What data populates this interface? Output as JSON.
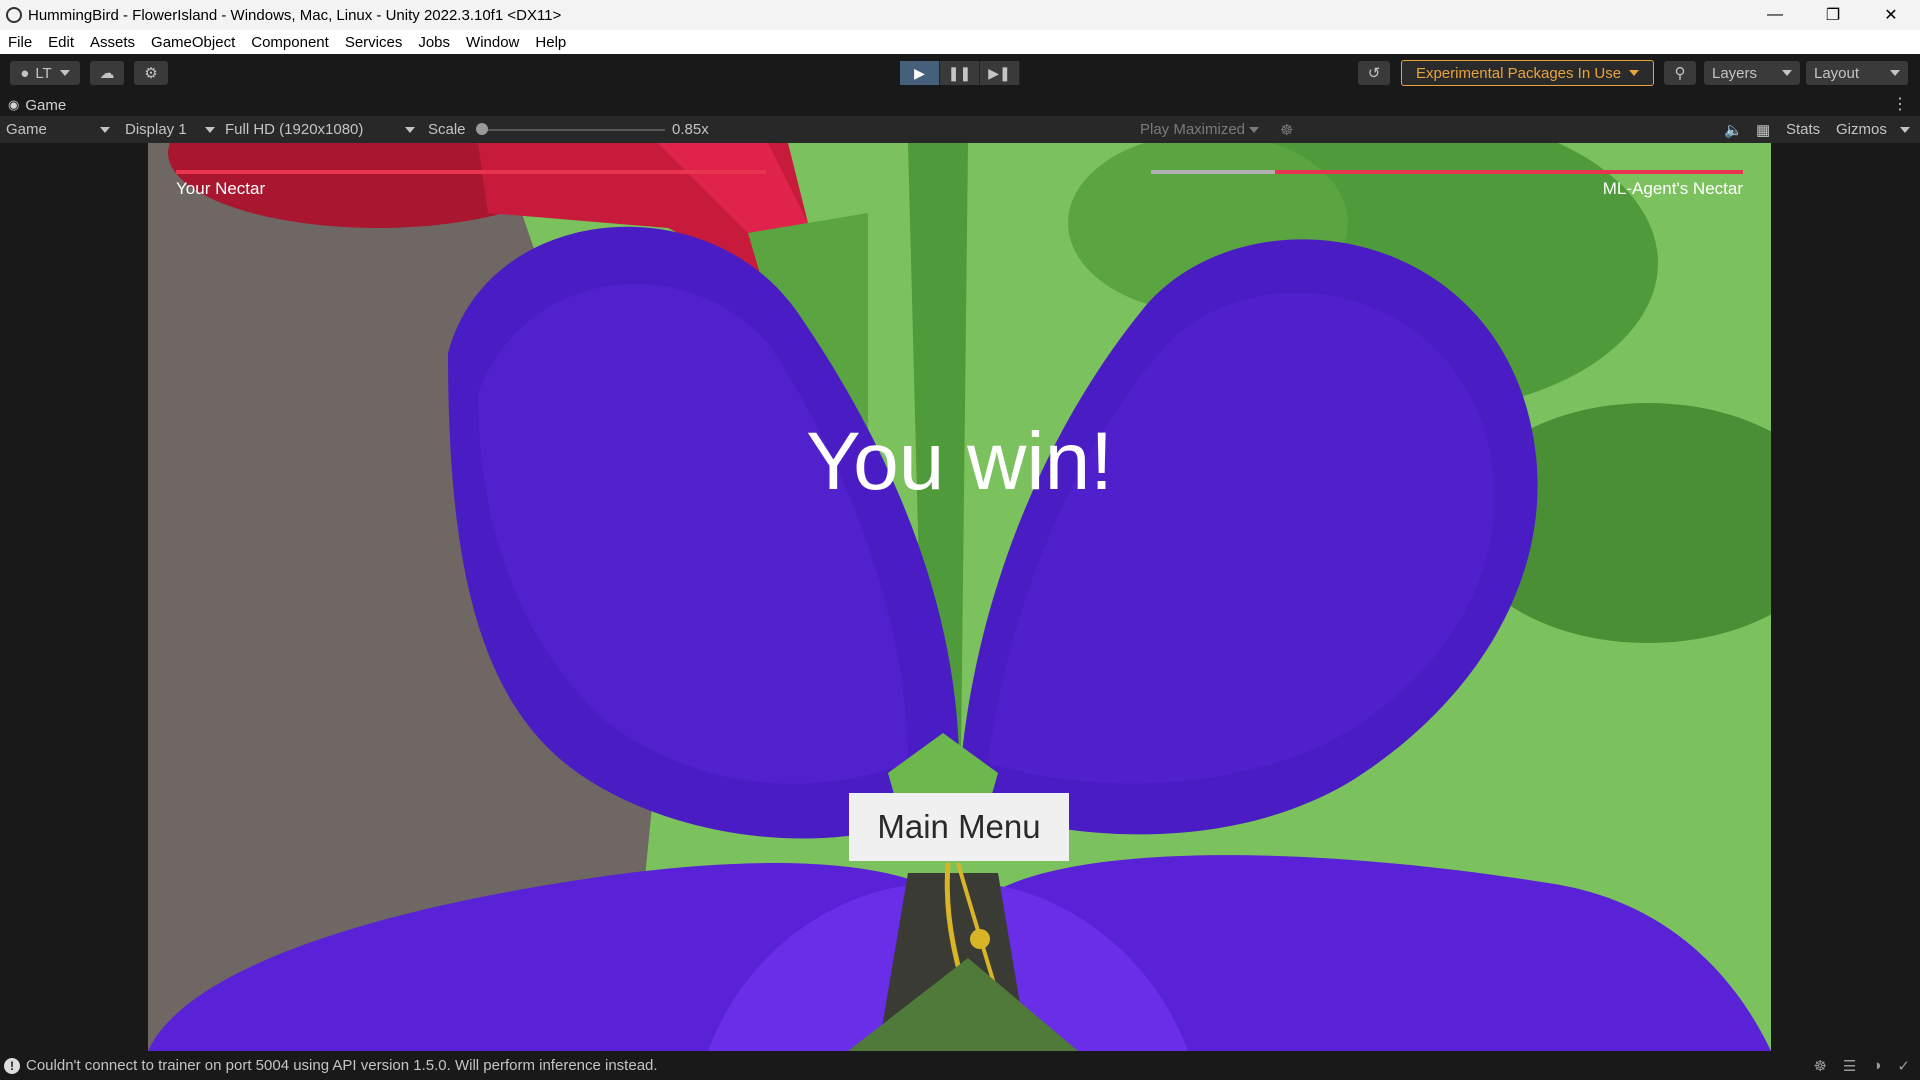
{
  "window": {
    "title": "HummingBird - FlowerIsland - Windows, Mac, Linux - Unity 2022.3.10f1 <DX11>",
    "minimize_icon": "minimize-icon",
    "maximize_icon": "restore-icon",
    "close_icon": "close-icon"
  },
  "menu": [
    "File",
    "Edit",
    "Assets",
    "GameObject",
    "Component",
    "Services",
    "Jobs",
    "Window",
    "Help"
  ],
  "toolbar": {
    "account_label": "LT",
    "experimental_label": "Experimental Packages In Use",
    "layers_label": "Layers",
    "layout_label": "Layout",
    "accent_color": "#e8a33d"
  },
  "tab": {
    "label": "Game"
  },
  "game_options": {
    "view_mode": "Game",
    "display": "Display 1",
    "resolution": "Full HD (1920x1080)",
    "scale_label": "Scale",
    "scale_value": "0.85x",
    "play_mode": "Play Maximized",
    "stats_label": "Stats",
    "gizmos_label": "Gizmos"
  },
  "game": {
    "your_nectar_label": "Your Nectar",
    "agent_nectar_label": "ML-Agent's Nectar",
    "your_nectar_fill": 1.0,
    "agent_nectar_fill": 0.79,
    "result_text": "You win!",
    "main_menu_label": "Main Menu",
    "nectar_color": "#e8344e",
    "petal_color": "#4a1cc4"
  },
  "status": {
    "message": "Couldn't connect to trainer on port 5004 using API version 1.5.0. Will perform inference instead."
  }
}
